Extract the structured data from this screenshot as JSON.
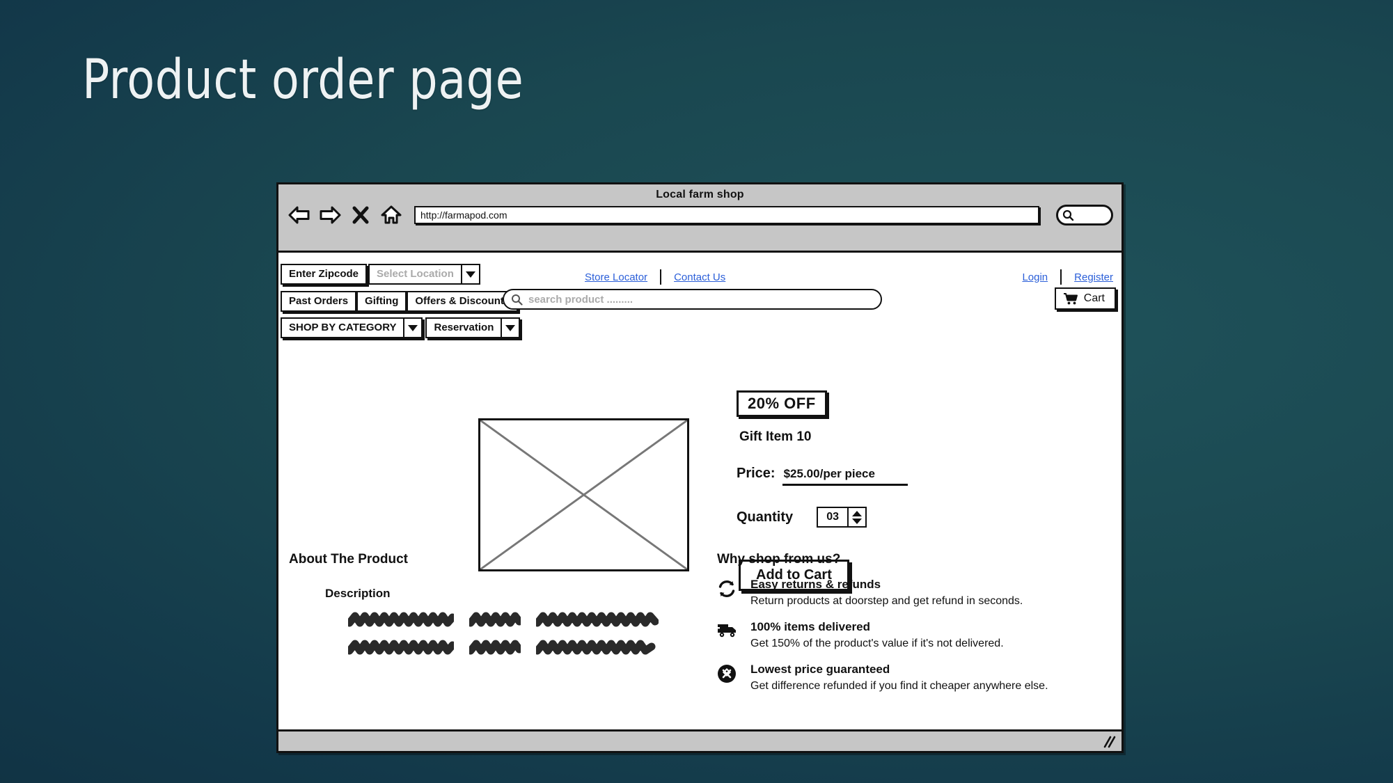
{
  "slide": {
    "title": "Product order page"
  },
  "browser": {
    "window_title": "Local farm shop",
    "url": "http://farmapod.com",
    "toolbar_icons": [
      "back-arrow-icon",
      "forward-arrow-icon",
      "stop-x-icon",
      "home-icon"
    ],
    "chrome_search_icon": "search-icon"
  },
  "utility_links": {
    "store_locator": "Store Locator",
    "contact_us": "Contact Us",
    "login": "Login",
    "register": "Register"
  },
  "location_row": {
    "zipcode_button": "Enter Zipcode",
    "location_select_value": "Select Location"
  },
  "nav_row": {
    "items": [
      {
        "label": "Past Orders"
      },
      {
        "label": "Gifting"
      },
      {
        "label": "Offers & Discounts"
      }
    ]
  },
  "search": {
    "placeholder": "search product .........",
    "icon": "search-icon"
  },
  "cart": {
    "label": "Cart",
    "icon": "shopping-cart-icon"
  },
  "category_row": {
    "shop_by_category": "SHOP BY CATEGORY",
    "reservation": "Reservation"
  },
  "product": {
    "image_placeholder": "image-placeholder-crossed-box",
    "discount_badge": "20% OFF",
    "name": "Gift Item 10",
    "price_label": "Price:",
    "price_value": "$25.00/per piece",
    "quantity_label": "Quantity",
    "quantity_value": "03",
    "add_to_cart": "Add to Cart"
  },
  "about": {
    "heading": "About The Product",
    "description_label": "Description",
    "placeholder_text": "scribbled-lorem-lines"
  },
  "why_shop": {
    "heading": "Why shop from us?",
    "features": [
      {
        "icon": "refresh-returns-icon",
        "title": "Easy returns & refunds",
        "desc": "Return products at doorstep and get refund in seconds."
      },
      {
        "icon": "delivery-truck-icon",
        "title": "100% items delivered",
        "desc": "Get 150% of the product's value if it's not delivered."
      },
      {
        "icon": "price-guarantee-icon",
        "title": "Lowest price guaranteed",
        "desc": "Get difference refunded if you find it cheaper anywhere else."
      }
    ]
  },
  "colors": {
    "background_dark": "#13394a",
    "background_teal": "#1f525a",
    "link_blue": "#2b5fd9",
    "chrome_gray": "#c6c6c6",
    "ink": "#111111"
  }
}
